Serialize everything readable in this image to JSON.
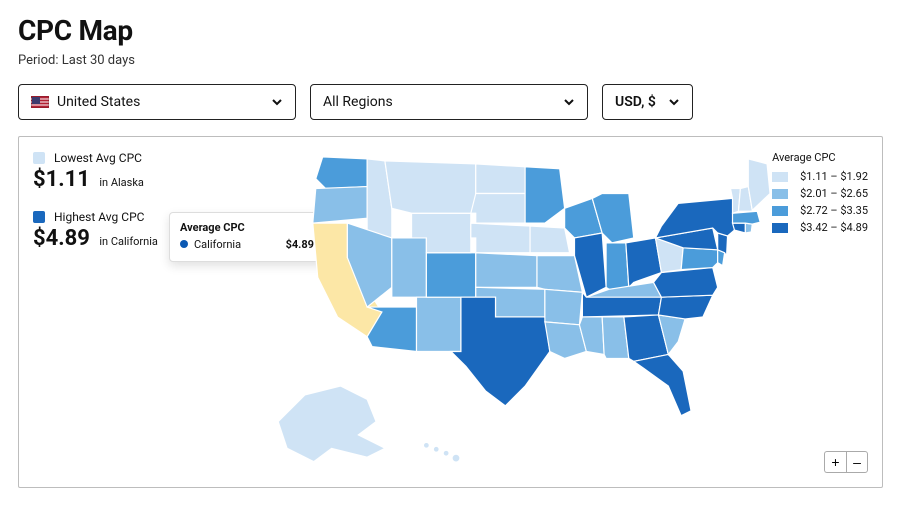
{
  "title": "CPC Map",
  "period_label": "Period: Last 30 days",
  "selects": {
    "country": "United States",
    "region": "All Regions",
    "currency": "USD, $"
  },
  "stats": {
    "lowest": {
      "label": "Lowest Avg CPC",
      "value": "$1.11",
      "where": "in Alaska",
      "swatch": "#cfe3f5"
    },
    "highest": {
      "label": "Highest Avg CPC",
      "value": "$4.89",
      "where": "in California",
      "swatch": "#1a68bd"
    }
  },
  "tooltip": {
    "title": "Average CPC",
    "state": "California",
    "value": "$4.89"
  },
  "legend": {
    "title": "Average CPC",
    "items": [
      {
        "label": "$1.11 – $1.92",
        "color": "#cfe3f5"
      },
      {
        "label": "$2.01 – $2.65",
        "color": "#89bfe8"
      },
      {
        "label": "$2.72 – $3.35",
        "color": "#4b9cda"
      },
      {
        "label": "$3.42 – $4.89",
        "color": "#1a68bd"
      }
    ]
  },
  "zoom": {
    "in": "+",
    "out": "–"
  },
  "chart_data": {
    "type": "choropleth-map",
    "region": "United States",
    "metric": "Average CPC (USD)",
    "highlighted_state": "California",
    "highlighted_value": 4.89,
    "bins": [
      {
        "range": [
          1.11,
          1.92
        ],
        "color": "#cfe3f5"
      },
      {
        "range": [
          2.01,
          2.65
        ],
        "color": "#89bfe8"
      },
      {
        "range": [
          2.72,
          3.35
        ],
        "color": "#4b9cda"
      },
      {
        "range": [
          3.42,
          4.89
        ],
        "color": "#1a68bd"
      }
    ],
    "state_bins": {
      "Alaska": 1,
      "Hawaii": 1,
      "Maine": 1,
      "Idaho": 1,
      "Montana": 1,
      "Wyoming": 1,
      "North Dakota": 1,
      "South Dakota": 1,
      "Nebraska": 1,
      "West Virginia": 1,
      "Vermont": 1,
      "New Hampshire": 1,
      "Iowa": 1,
      "Oregon": 2,
      "Nevada": 2,
      "Utah": 2,
      "New Mexico": 2,
      "Kansas": 2,
      "Oklahoma": 2,
      "Arkansas": 2,
      "Mississippi": 2,
      "Alabama": 2,
      "Louisiana": 2,
      "Kentucky": 2,
      "South Carolina": 2,
      "Rhode Island": 2,
      "Missouri": 2,
      "Washington": 3,
      "Arizona": 3,
      "Colorado": 3,
      "Minnesota": 3,
      "Wisconsin": 3,
      "Michigan": 3,
      "Indiana": 3,
      "Massachusetts": 3,
      "Delaware": 3,
      "Maryland": 3,
      "California": 4,
      "Texas": 4,
      "Illinois": 4,
      "Ohio": 4,
      "Pennsylvania": 4,
      "New York": 4,
      "New Jersey": 4,
      "Connecticut": 4,
      "Virginia": 4,
      "North Carolina": 4,
      "Tennessee": 4,
      "Georgia": 4,
      "Florida": 4
    },
    "extremes": {
      "min_state": "Alaska",
      "min_value": 1.11,
      "max_state": "California",
      "max_value": 4.89
    }
  }
}
